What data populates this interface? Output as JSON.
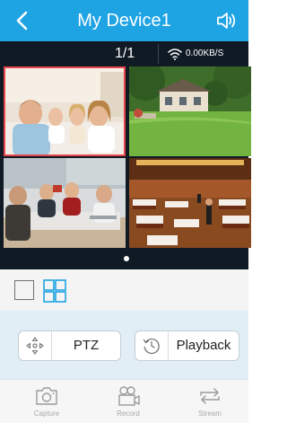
{
  "header": {
    "title": "My Device1",
    "back_icon": "chevron-left-icon",
    "audio_icon": "speaker-icon"
  },
  "status": {
    "page_indicator": "1/1",
    "speed": "0.00KB/S",
    "wifi_icon": "wifi-icon"
  },
  "grid": {
    "selected_channel": 1,
    "channels": 4
  },
  "pager": {
    "pages": 1,
    "current": 1
  },
  "layout_options": [
    {
      "name": "single-view",
      "icon": "single-view-icon"
    },
    {
      "name": "quad-view",
      "icon": "quad-view-icon",
      "active": true
    }
  ],
  "controls": {
    "ptz_label": "PTZ",
    "playback_label": "Playback"
  },
  "bottom_tabs": [
    {
      "label": "Capture",
      "icon": "camera-icon"
    },
    {
      "label": "Record",
      "icon": "video-camera-icon"
    },
    {
      "label": "Stream",
      "icon": "swap-icon"
    }
  ],
  "colors": {
    "accent": "#1ea3e3",
    "dark_bg": "#101a25",
    "selection": "#e7474c",
    "control_bg": "#e1eef6"
  }
}
